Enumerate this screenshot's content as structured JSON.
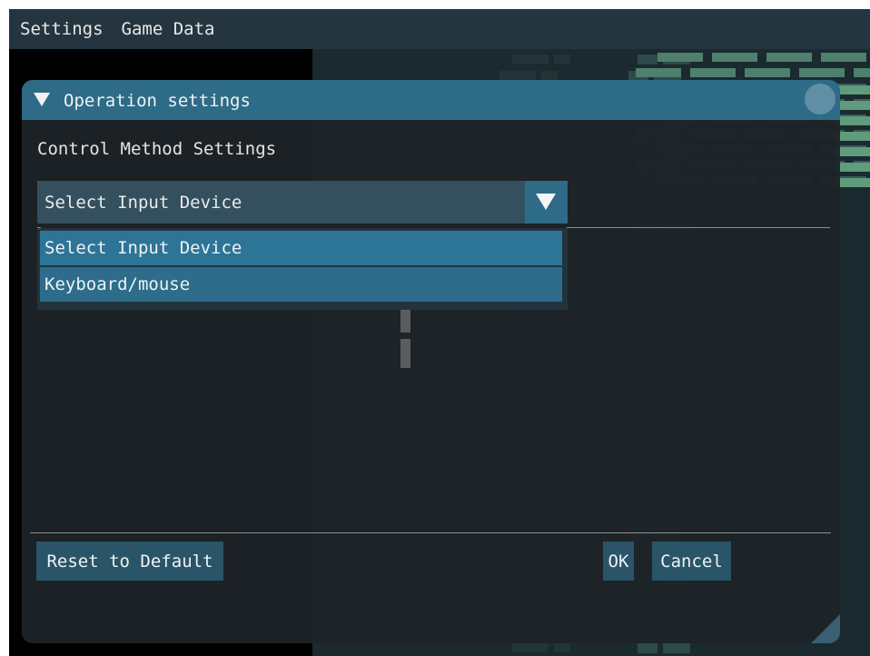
{
  "menubar": {
    "items": [
      {
        "label": "Settings"
      },
      {
        "label": "Game Data"
      }
    ]
  },
  "dialog": {
    "title": "Operation settings",
    "section_label": "Control Method Settings",
    "input_device": {
      "selected": "Select Input Device",
      "options": [
        "Select Input Device",
        "Keyboard/mouse"
      ]
    },
    "buttons": {
      "reset": "Reset to Default",
      "ok": "OK",
      "cancel": "Cancel"
    }
  },
  "colors": {
    "title_bar": "#2e6b87",
    "dialog_bg": "#1e2327",
    "menubar_bg": "#24353f",
    "button_bg": "#2a5468",
    "option_highlight": "#2c7597"
  },
  "icons": [
    "collapse-triangle-icon",
    "dropdown-arrow-icon",
    "close-icon",
    "resize-grip-icon"
  ]
}
